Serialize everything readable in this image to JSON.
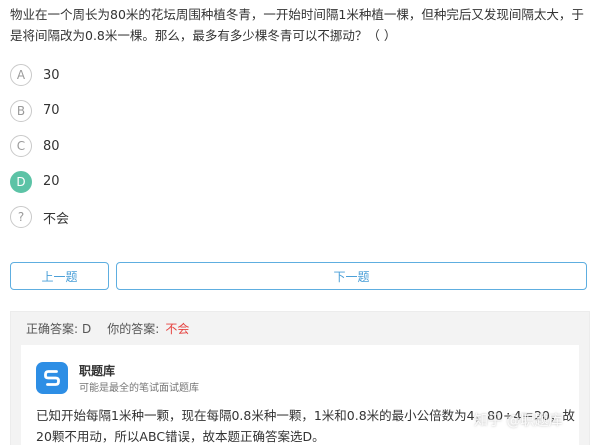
{
  "question": {
    "text": "物业在一个周长为80米的花坛周围种植冬青，一开始时间隔1米种植一棵，但种完后又发现间隔太大，于是将间隔改为0.8米一棵。那么，最多有多少棵冬青可以不挪动？（ ）"
  },
  "options": [
    {
      "letter": "A",
      "label": "30"
    },
    {
      "letter": "B",
      "label": "70"
    },
    {
      "letter": "C",
      "label": "80"
    },
    {
      "letter": "D",
      "label": "20"
    },
    {
      "letter": "?",
      "label": "不会"
    }
  ],
  "nav": {
    "prev_label": "上一题",
    "next_label": "下一题"
  },
  "answer": {
    "correct_label": "正确答案:",
    "correct_value": "D",
    "yours_label": "你的答案:",
    "yours_value": "不会"
  },
  "brand": {
    "name": "职题库",
    "tagline": "可能是最全的笔试面试题库",
    "color": "#2d8ee5"
  },
  "explanation": {
    "text": "已知开始每隔1米种一颗，现在每隔0.8米种一颗，1米和0.8米的最小公倍数为4，80÷4＝20，故20颗不用动，所以ABC错误，故本题正确答案选D。"
  },
  "watermark": {
    "text": "知乎 @职题库"
  },
  "colors": {
    "selected": "#5cc3a6",
    "button": "#4a9fd8",
    "wrong": "#e64340"
  }
}
